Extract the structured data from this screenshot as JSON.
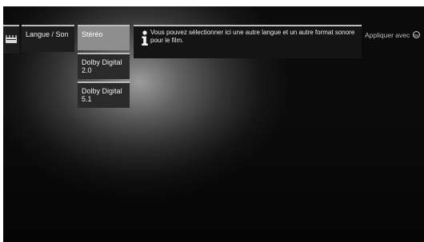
{
  "menu": {
    "icon": "clapperboard-icon",
    "category_label": "Langue / Son"
  },
  "options": [
    {
      "label": "Stéréo",
      "selected": true
    },
    {
      "label": "Dolby Digital 2.0",
      "selected": false
    },
    {
      "label": "Dolby Digital 5.1",
      "selected": false
    }
  ],
  "info": {
    "icon": "info-icon",
    "text": "Vous pouvez sélectionner ici une autre langue et un autre format sonore pour le film."
  },
  "footer_hint": {
    "text": "Appliquer avec",
    "button_icon": "ok-button-icon",
    "button_label": "OK"
  },
  "colors": {
    "panel": "#1d1d1d",
    "selected": "#8e8e8e",
    "text": "#ededed",
    "highlight_line": "#bdbdbd"
  }
}
